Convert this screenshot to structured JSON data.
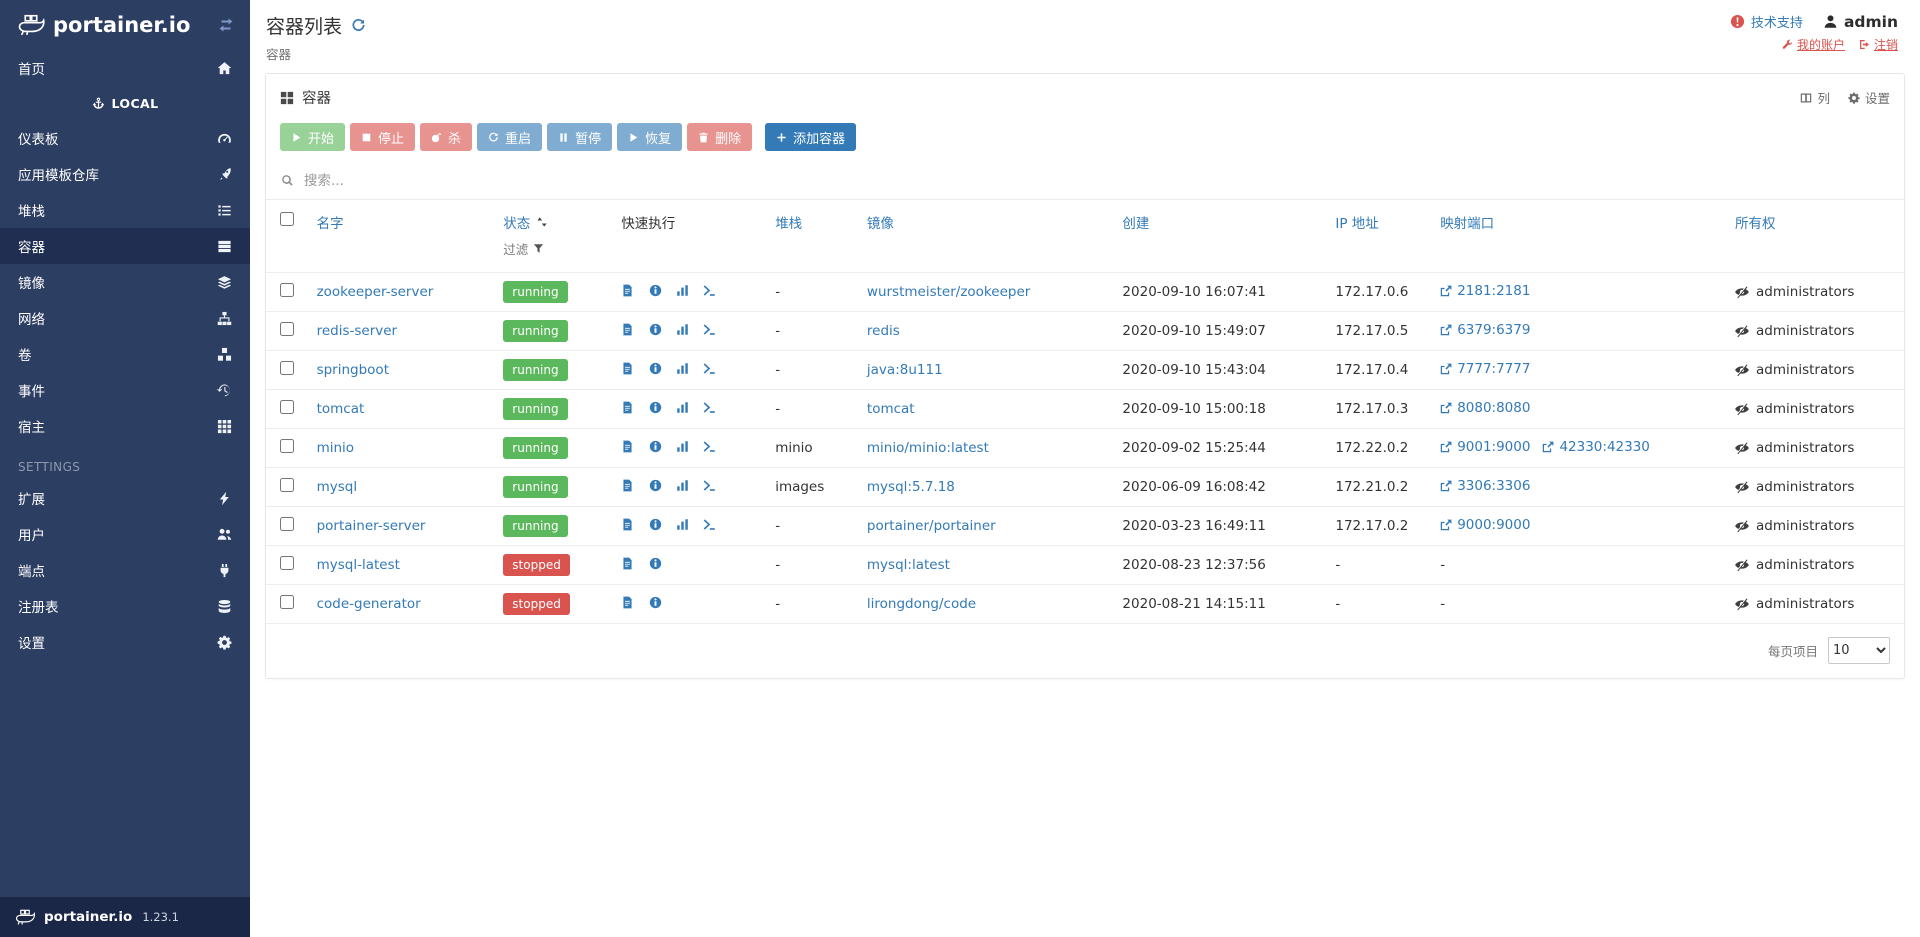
{
  "colors": {
    "accent": "#337ab7",
    "success": "#5cb85c",
    "danger": "#d9534f",
    "sidebar_bg": "#2d3e63",
    "sidebar_active_bg": "#202e52"
  },
  "sidebar": {
    "brand": "portainer.io",
    "home": {
      "label": "首页",
      "icon": "home"
    },
    "endpoint_header": {
      "label": "LOCAL",
      "icon": "anchor"
    },
    "local_items": [
      {
        "label": "仪表板",
        "icon": "tachometer"
      },
      {
        "label": "应用模板仓库",
        "icon": "rocket"
      },
      {
        "label": "堆栈",
        "icon": "list"
      },
      {
        "label": "容器",
        "icon": "server",
        "active": true
      },
      {
        "label": "镜像",
        "icon": "layers"
      },
      {
        "label": "网络",
        "icon": "sitemap"
      },
      {
        "label": "卷",
        "icon": "cubes"
      },
      {
        "label": "事件",
        "icon": "history"
      },
      {
        "label": "宿主",
        "icon": "th"
      }
    ],
    "settings_header": "SETTINGS",
    "settings_items": [
      {
        "label": "扩展",
        "icon": "bolt"
      },
      {
        "label": "用户",
        "icon": "users"
      },
      {
        "label": "端点",
        "icon": "plug"
      },
      {
        "label": "注册表",
        "icon": "database"
      },
      {
        "label": "设置",
        "icon": "cogs"
      }
    ],
    "footer": {
      "brand": "portainer.io",
      "version": "1.23.1"
    }
  },
  "header": {
    "title": "容器列表",
    "subtitle": "容器",
    "support_label": "技术支持",
    "username": "admin",
    "account_label": "我的账户",
    "logout_label": "注销"
  },
  "panel": {
    "title": "容器",
    "columns_label": "列",
    "settings_label": "设置"
  },
  "toolbar": {
    "buttons": [
      {
        "label": "开始",
        "icon": "play",
        "style": "success",
        "disabled": true
      },
      {
        "label": "停止",
        "icon": "stop",
        "style": "danger",
        "disabled": true
      },
      {
        "label": "杀",
        "icon": "bomb",
        "style": "danger",
        "disabled": true
      },
      {
        "label": "重启",
        "icon": "refresh",
        "style": "primary",
        "disabled": true
      },
      {
        "label": "暂停",
        "icon": "pause",
        "style": "primary",
        "disabled": true
      },
      {
        "label": "恢复",
        "icon": "play",
        "style": "primary",
        "disabled": true
      },
      {
        "label": "删除",
        "icon": "trash",
        "style": "danger",
        "disabled": true
      },
      {
        "label": "添加容器",
        "icon": "plus",
        "style": "primary",
        "disabled": false
      }
    ]
  },
  "search": {
    "placeholder": "搜索..."
  },
  "table": {
    "headers": {
      "name": "名字",
      "state": "状态",
      "state_filter": "过滤",
      "quick_actions": "快速执行",
      "stack": "堆栈",
      "image": "镜像",
      "created": "创建",
      "ip": "IP 地址",
      "ports": "映射端口",
      "ownership": "所有权"
    },
    "rows": [
      {
        "name": "zookeeper-server",
        "state": "running",
        "stack": "-",
        "image": "wurstmeister/zookeeper",
        "created": "2020-09-10 16:07:41",
        "ip": "172.17.0.6",
        "ports": [
          "2181:2181"
        ],
        "ownership": "administrators"
      },
      {
        "name": "redis-server",
        "state": "running",
        "stack": "-",
        "image": "redis",
        "created": "2020-09-10 15:49:07",
        "ip": "172.17.0.5",
        "ports": [
          "6379:6379"
        ],
        "ownership": "administrators"
      },
      {
        "name": "springboot",
        "state": "running",
        "stack": "-",
        "image": "java:8u111",
        "created": "2020-09-10 15:43:04",
        "ip": "172.17.0.4",
        "ports": [
          "7777:7777"
        ],
        "ownership": "administrators"
      },
      {
        "name": "tomcat",
        "state": "running",
        "stack": "-",
        "image": "tomcat",
        "created": "2020-09-10 15:00:18",
        "ip": "172.17.0.3",
        "ports": [
          "8080:8080"
        ],
        "ownership": "administrators"
      },
      {
        "name": "minio",
        "state": "running",
        "stack": "minio",
        "image": "minio/minio:latest",
        "created": "2020-09-02 15:25:44",
        "ip": "172.22.0.2",
        "ports": [
          "9001:9000",
          "42330:42330"
        ],
        "ownership": "administrators"
      },
      {
        "name": "mysql",
        "state": "running",
        "stack": "images",
        "image": "mysql:5.7.18",
        "created": "2020-06-09 16:08:42",
        "ip": "172.21.0.2",
        "ports": [
          "3306:3306"
        ],
        "ownership": "administrators"
      },
      {
        "name": "portainer-server",
        "state": "running",
        "stack": "-",
        "image": "portainer/portainer",
        "created": "2020-03-23 16:49:11",
        "ip": "172.17.0.2",
        "ports": [
          "9000:9000"
        ],
        "ownership": "administrators"
      },
      {
        "name": "mysql-latest",
        "state": "stopped",
        "stack": "-",
        "image": "mysql:latest",
        "created": "2020-08-23 12:37:56",
        "ip": "-",
        "ports": [],
        "ownership": "administrators"
      },
      {
        "name": "code-generator",
        "state": "stopped",
        "stack": "-",
        "image": "lirongdong/code",
        "created": "2020-08-21 14:15:11",
        "ip": "-",
        "ports": [],
        "ownership": "administrators"
      }
    ]
  },
  "pagination": {
    "label": "每页项目",
    "page_size": "10"
  }
}
